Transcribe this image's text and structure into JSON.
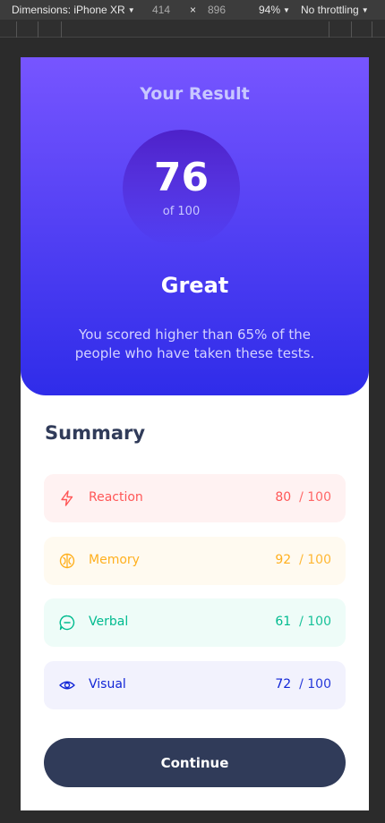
{
  "devtools": {
    "device_label": "Dimensions: iPhone XR",
    "width": "414",
    "times": "×",
    "height": "896",
    "zoom": "94%",
    "throttling": "No throttling"
  },
  "result": {
    "title": "Your Result",
    "score": "76",
    "score_max": "of 100",
    "rating": "Great",
    "description": "You scored higher than 65% of the people who have taken these tests."
  },
  "summary": {
    "title": "Summary",
    "items": [
      {
        "icon": "lightning-icon",
        "label": "Reaction",
        "score": "80",
        "max": "/ 100",
        "color": "#ff5757"
      },
      {
        "icon": "brain-icon",
        "label": "Memory",
        "score": "92",
        "max": "/ 100",
        "color": "#ffb01f"
      },
      {
        "icon": "chat-bubble-icon",
        "label": "Verbal",
        "score": "61",
        "max": "/ 100",
        "color": "#00bb8f"
      },
      {
        "icon": "eye-icon",
        "label": "Visual",
        "score": "72",
        "max": "/ 100",
        "color": "#1125d6"
      }
    ]
  },
  "actions": {
    "continue_label": "Continue"
  },
  "colors": {
    "gradient_top": "#7755ff",
    "gradient_bottom": "#2f2ce9",
    "dark_navy": "#303b59"
  }
}
